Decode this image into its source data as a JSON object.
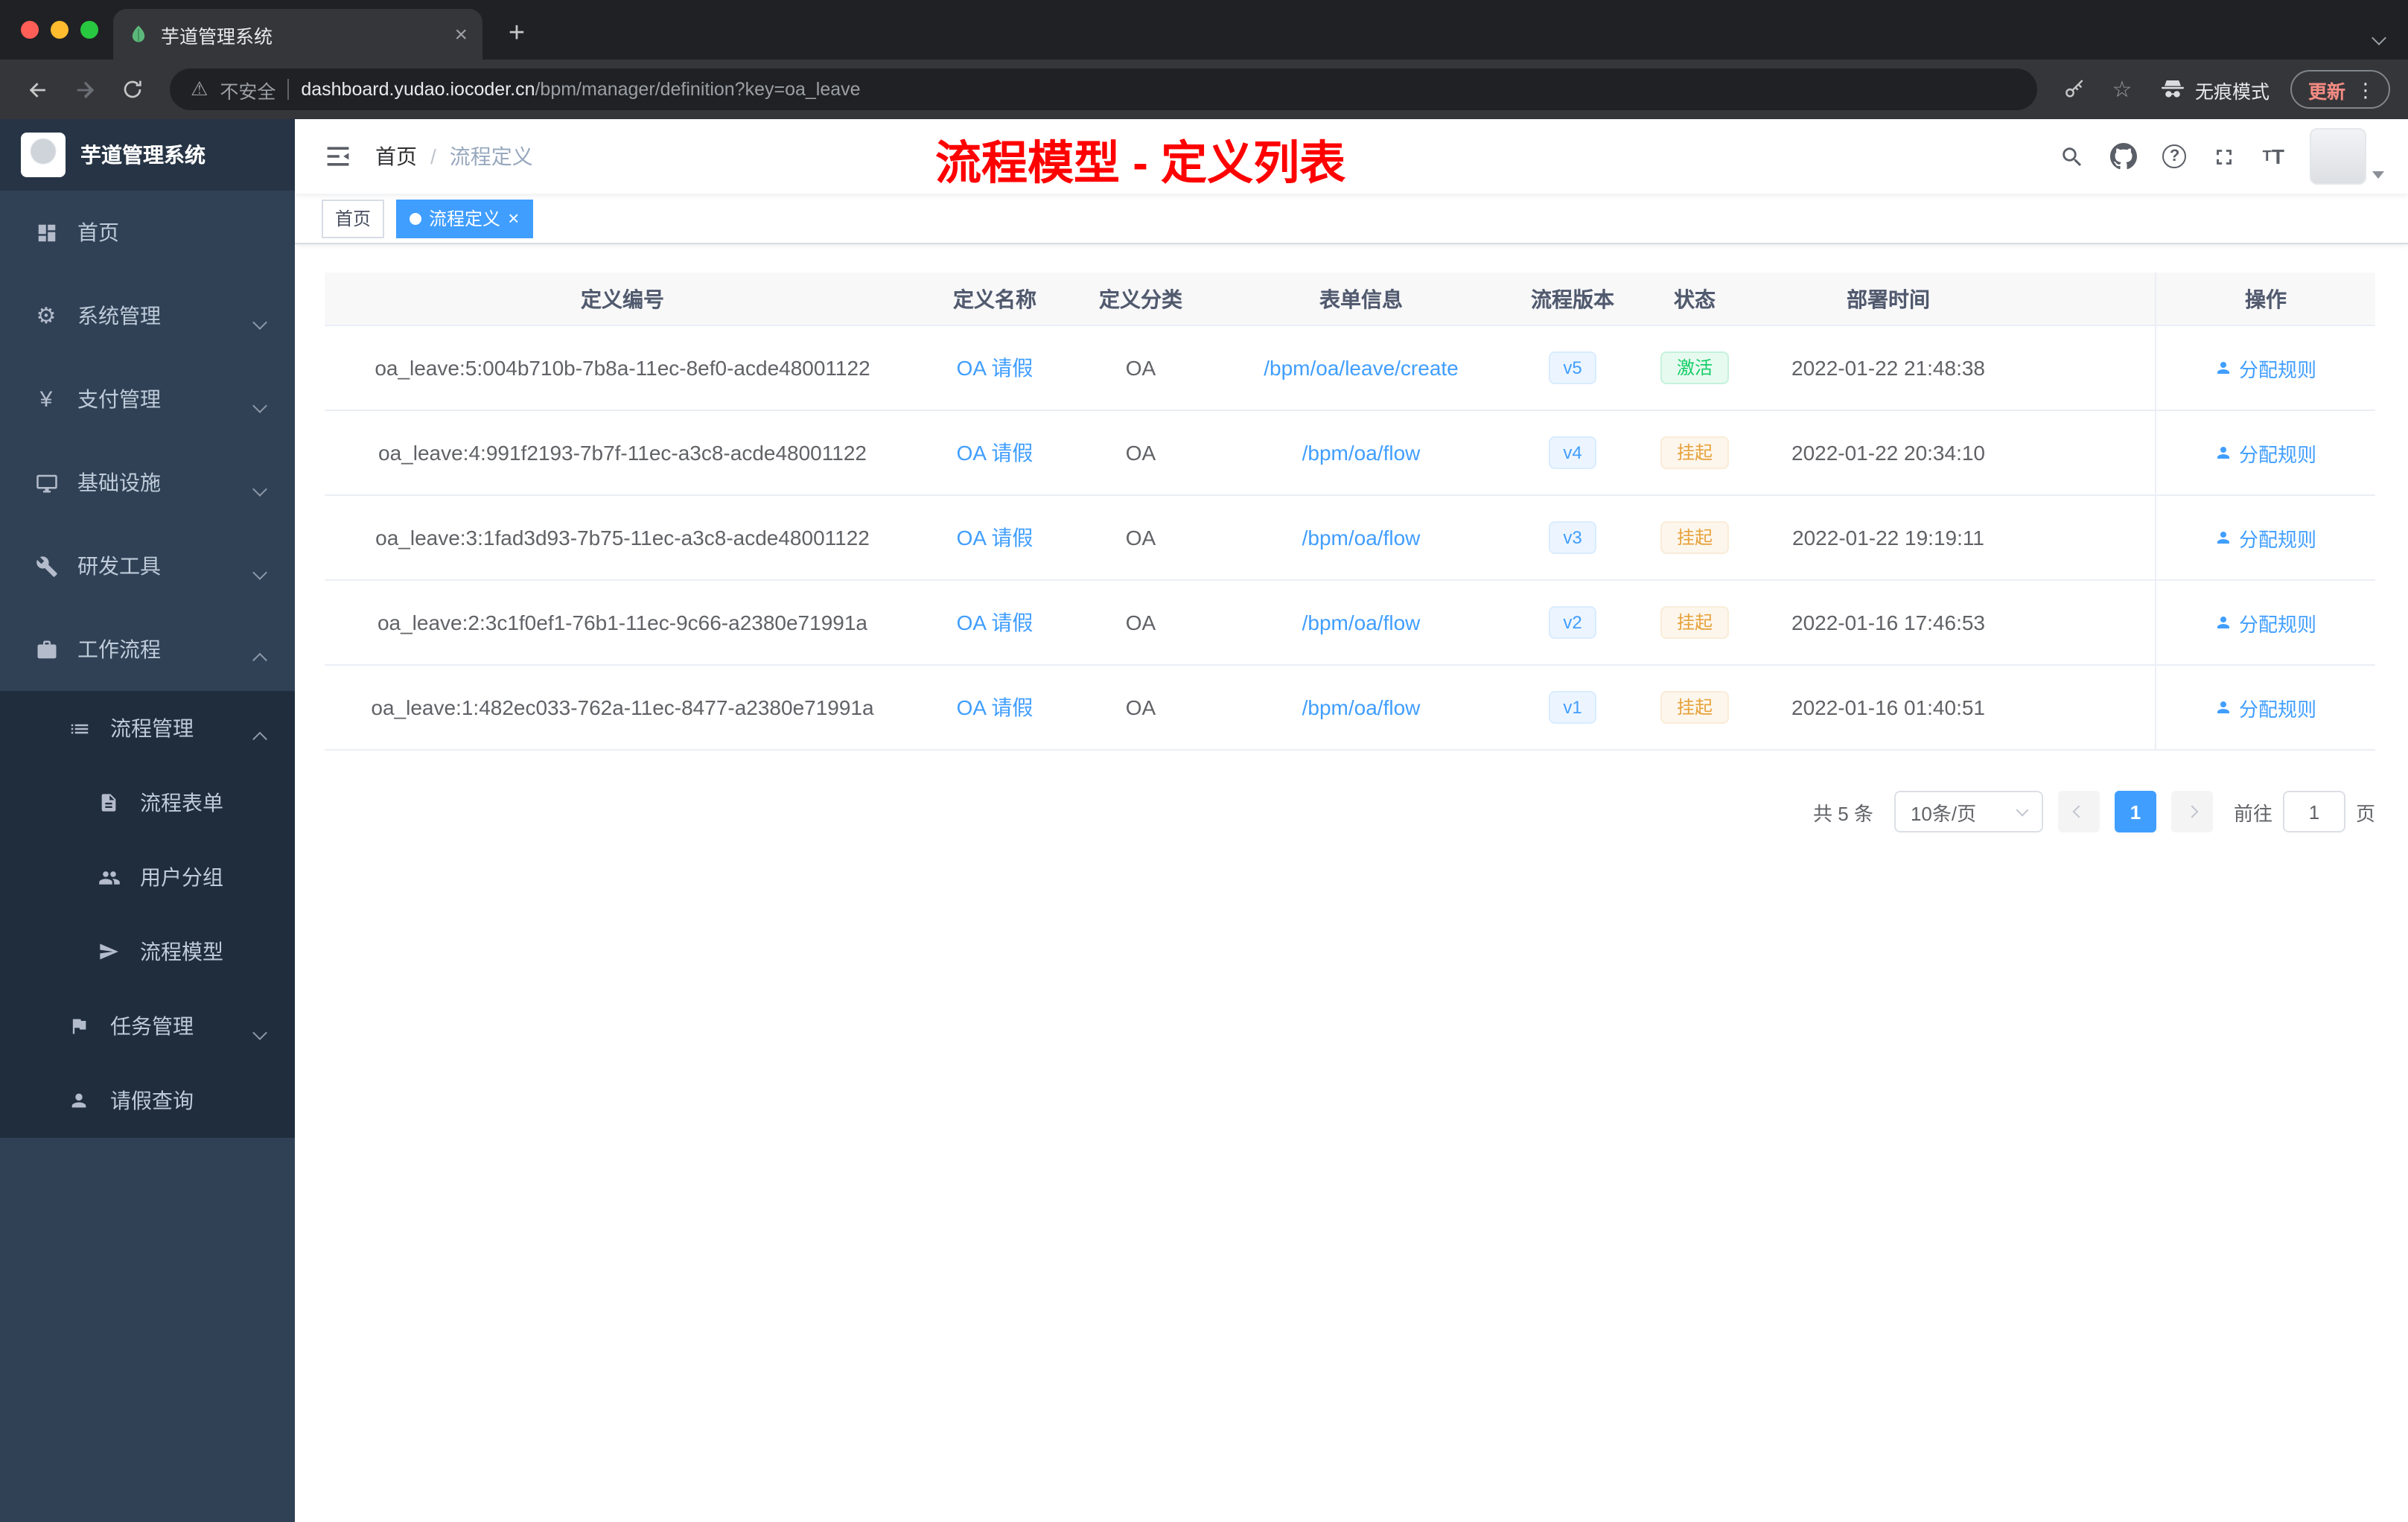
{
  "browser": {
    "tab_title": "芋道管理系统",
    "security_label": "不安全",
    "url_domain": "dashboard.yudao.iocoder.cn",
    "url_path": "/bpm/manager/definition?key=oa_leave",
    "incognito_label": "无痕模式",
    "update_label": "更新"
  },
  "sidebar": {
    "logo_title": "芋道管理系统",
    "items": [
      {
        "label": "首页"
      },
      {
        "label": "系统管理"
      },
      {
        "label": "支付管理"
      },
      {
        "label": "基础设施"
      },
      {
        "label": "研发工具"
      },
      {
        "label": "工作流程"
      },
      {
        "label": "流程管理"
      },
      {
        "label": "流程表单"
      },
      {
        "label": "用户分组"
      },
      {
        "label": "流程模型"
      },
      {
        "label": "任务管理"
      },
      {
        "label": "请假查询"
      }
    ]
  },
  "navbar": {
    "breadcrumb_home": "首页",
    "breadcrumb_sep": "/",
    "breadcrumb_current": "流程定义",
    "annotation": "流程模型 - 定义列表"
  },
  "tags": {
    "home": "首页",
    "current": "流程定义",
    "close": "×"
  },
  "table": {
    "columns": [
      "定义编号",
      "定义名称",
      "定义分类",
      "表单信息",
      "流程版本",
      "状态",
      "部署时间",
      "操作"
    ],
    "rows": [
      {
        "id": "oa_leave:5:004b710b-7b8a-11ec-8ef0-acde48001122",
        "name": "OA 请假",
        "category": "OA",
        "form": "/bpm/oa/leave/create",
        "version": "v5",
        "status": "激活",
        "time": "2022-01-22 21:48:38",
        "action": "分配规则"
      },
      {
        "id": "oa_leave:4:991f2193-7b7f-11ec-a3c8-acde48001122",
        "name": "OA 请假",
        "category": "OA",
        "form": "/bpm/oa/flow",
        "version": "v4",
        "status": "挂起",
        "time": "2022-01-22 20:34:10",
        "action": "分配规则"
      },
      {
        "id": "oa_leave:3:1fad3d93-7b75-11ec-a3c8-acde48001122",
        "name": "OA 请假",
        "category": "OA",
        "form": "/bpm/oa/flow",
        "version": "v3",
        "status": "挂起",
        "time": "2022-01-22 19:19:11",
        "action": "分配规则"
      },
      {
        "id": "oa_leave:2:3c1f0ef1-76b1-11ec-9c66-a2380e71991a",
        "name": "OA 请假",
        "category": "OA",
        "form": "/bpm/oa/flow",
        "version": "v2",
        "status": "挂起",
        "time": "2022-01-16 17:46:53",
        "action": "分配规则"
      },
      {
        "id": "oa_leave:1:482ec033-762a-11ec-8477-a2380e71991a",
        "name": "OA 请假",
        "category": "OA",
        "form": "/bpm/oa/flow",
        "version": "v1",
        "status": "挂起",
        "time": "2022-01-16 01:40:51",
        "action": "分配规则"
      }
    ]
  },
  "pagination": {
    "total": "共 5 条",
    "page_size": "10条/页",
    "page": "1",
    "goto_label": "前往",
    "goto_value": "1",
    "page_unit": "页"
  }
}
